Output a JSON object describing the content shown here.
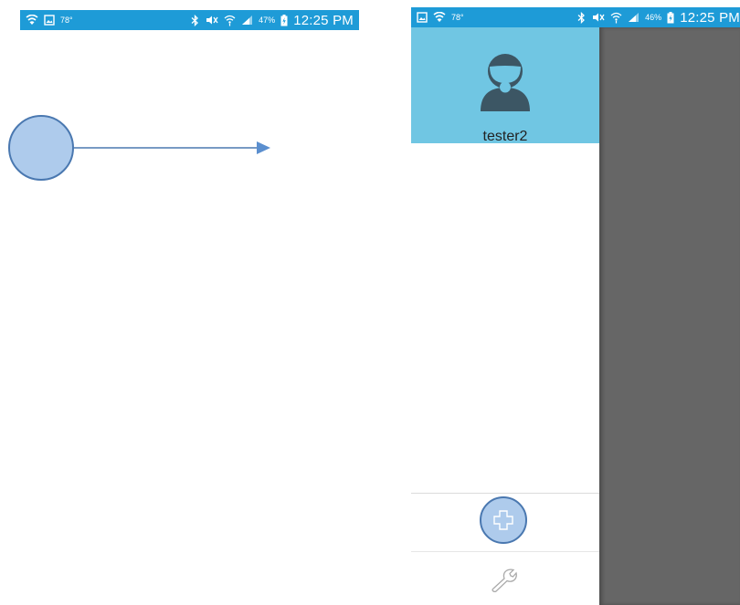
{
  "status_left": {
    "temperature": "78°",
    "battery_percent": "47%",
    "time": "12:25 PM",
    "icons": [
      "wifi-icon",
      "gallery-icon",
      "bluetooth-icon",
      "mute-icon",
      "hotspot-icon",
      "signal-icon",
      "battery-charging-icon"
    ]
  },
  "status_right": {
    "temperature": "78°",
    "battery_percent": "46%",
    "time": "12:25 PM",
    "icons": [
      "gallery-icon",
      "wifi-icon",
      "bluetooth-icon",
      "mute-icon",
      "hotspot-icon",
      "signal-icon",
      "battery-charging-icon"
    ]
  },
  "gesture": {
    "icons": [
      "touch-point-icon",
      "swipe-right-arrow-icon"
    ]
  },
  "drawer": {
    "username": "tester2",
    "icons": [
      "user-avatar-icon",
      "plus-icon",
      "wrench-icon"
    ]
  },
  "colors": {
    "status_bar": "#1e9bd7",
    "drawer_header": "#70c6e3",
    "scrim": "#666666",
    "touch_fill": "#aecbec",
    "touch_stroke": "#4a78b0",
    "avatar": "#3c5664"
  }
}
